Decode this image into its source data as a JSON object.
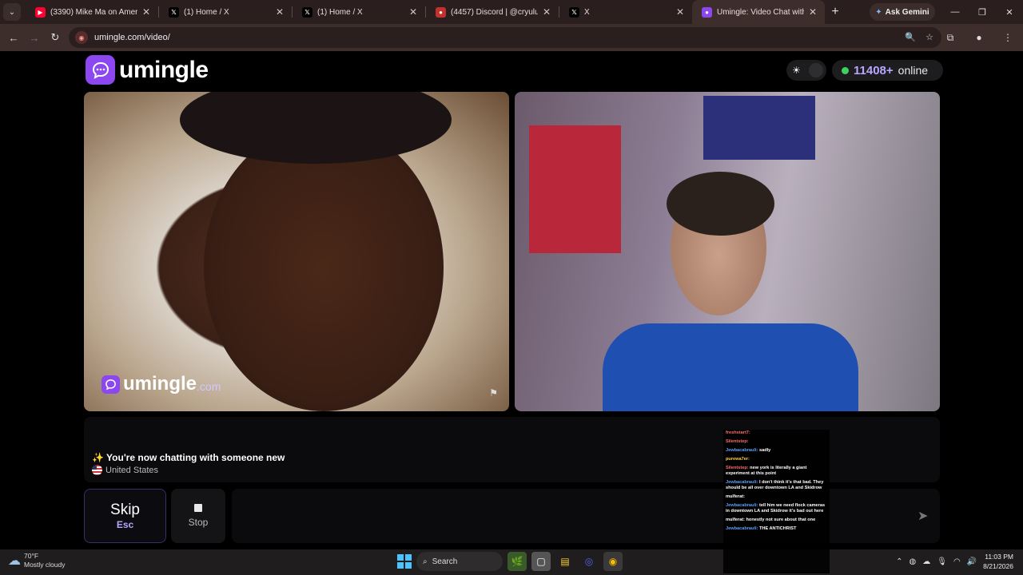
{
  "browser": {
    "tabs": [
      {
        "title": "(3390) Mike Ma on America |",
        "favicon": "youtube-icon",
        "color": "#ff0033"
      },
      {
        "title": "(1) Home / X",
        "favicon": "x-icon",
        "color": "#000000"
      },
      {
        "title": "(1) Home / X",
        "favicon": "x-icon",
        "color": "#000000"
      },
      {
        "title": "(4457) Discord | @cryulu",
        "favicon": "discord-icon",
        "color": "#c4302b"
      },
      {
        "title": "X",
        "favicon": "x-icon",
        "color": "#000000"
      },
      {
        "title": "Umingle: Video Chat with",
        "favicon": "umingle-icon",
        "color": "#8c47f0",
        "active": true
      }
    ],
    "gemini_label": "Ask Gemini",
    "url": "umingle.com/video/"
  },
  "site": {
    "brand": "umingle",
    "online_count": "11408+",
    "online_label": "online",
    "accent": "#8c47f0",
    "online_dot_color": "#3fd15e"
  },
  "video": {
    "watermark_brand": "umingle",
    "watermark_domain": ".com"
  },
  "chat": {
    "system_message": "✨ You're now chatting with someone new",
    "country": "United States",
    "input_placeholder": ""
  },
  "controls": {
    "skip_label": "Skip",
    "skip_key": "Esc",
    "stop_label": "Stop"
  },
  "stream_chat": [
    {
      "user": "freshstart7:",
      "text": "",
      "color": "#ff6b6b"
    },
    {
      "user": "Silentstep:",
      "text": "",
      "color": "#ff6b6b"
    },
    {
      "user": "Jewbacabrauli:",
      "text": "sadly",
      "color": "#5aa0ff"
    },
    {
      "user": "purewa7er:",
      "text": "",
      "color": "#ffd23f"
    },
    {
      "user": "Silentstep:",
      "text": "new york is literally a giant experiment at this point",
      "color": "#ff6b6b"
    },
    {
      "user": "Jewbacabrauli:",
      "text": "I don't think it's that bad. They should be all over downtown LA and Skidrow",
      "color": "#5aa0ff"
    },
    {
      "user": "mulferat:",
      "text": "",
      "color": "#ffffff"
    },
    {
      "user": "Jewbacabrauli:",
      "text": "tell him we need flock cameras in downtown LA and Skidrow it's bad out here",
      "color": "#5aa0ff"
    },
    {
      "user": "mulferat:",
      "text": "honestly not sure about that one",
      "color": "#ffffff"
    },
    {
      "user": "Jewbacabrauli:",
      "text": "THE ANTICHRIST",
      "color": "#5aa0ff"
    }
  ],
  "taskbar": {
    "temperature": "70°F",
    "weather": "Mostly cloudy",
    "search_label": "Search",
    "time": "11:03 PM",
    "date": "8/21/2026"
  }
}
